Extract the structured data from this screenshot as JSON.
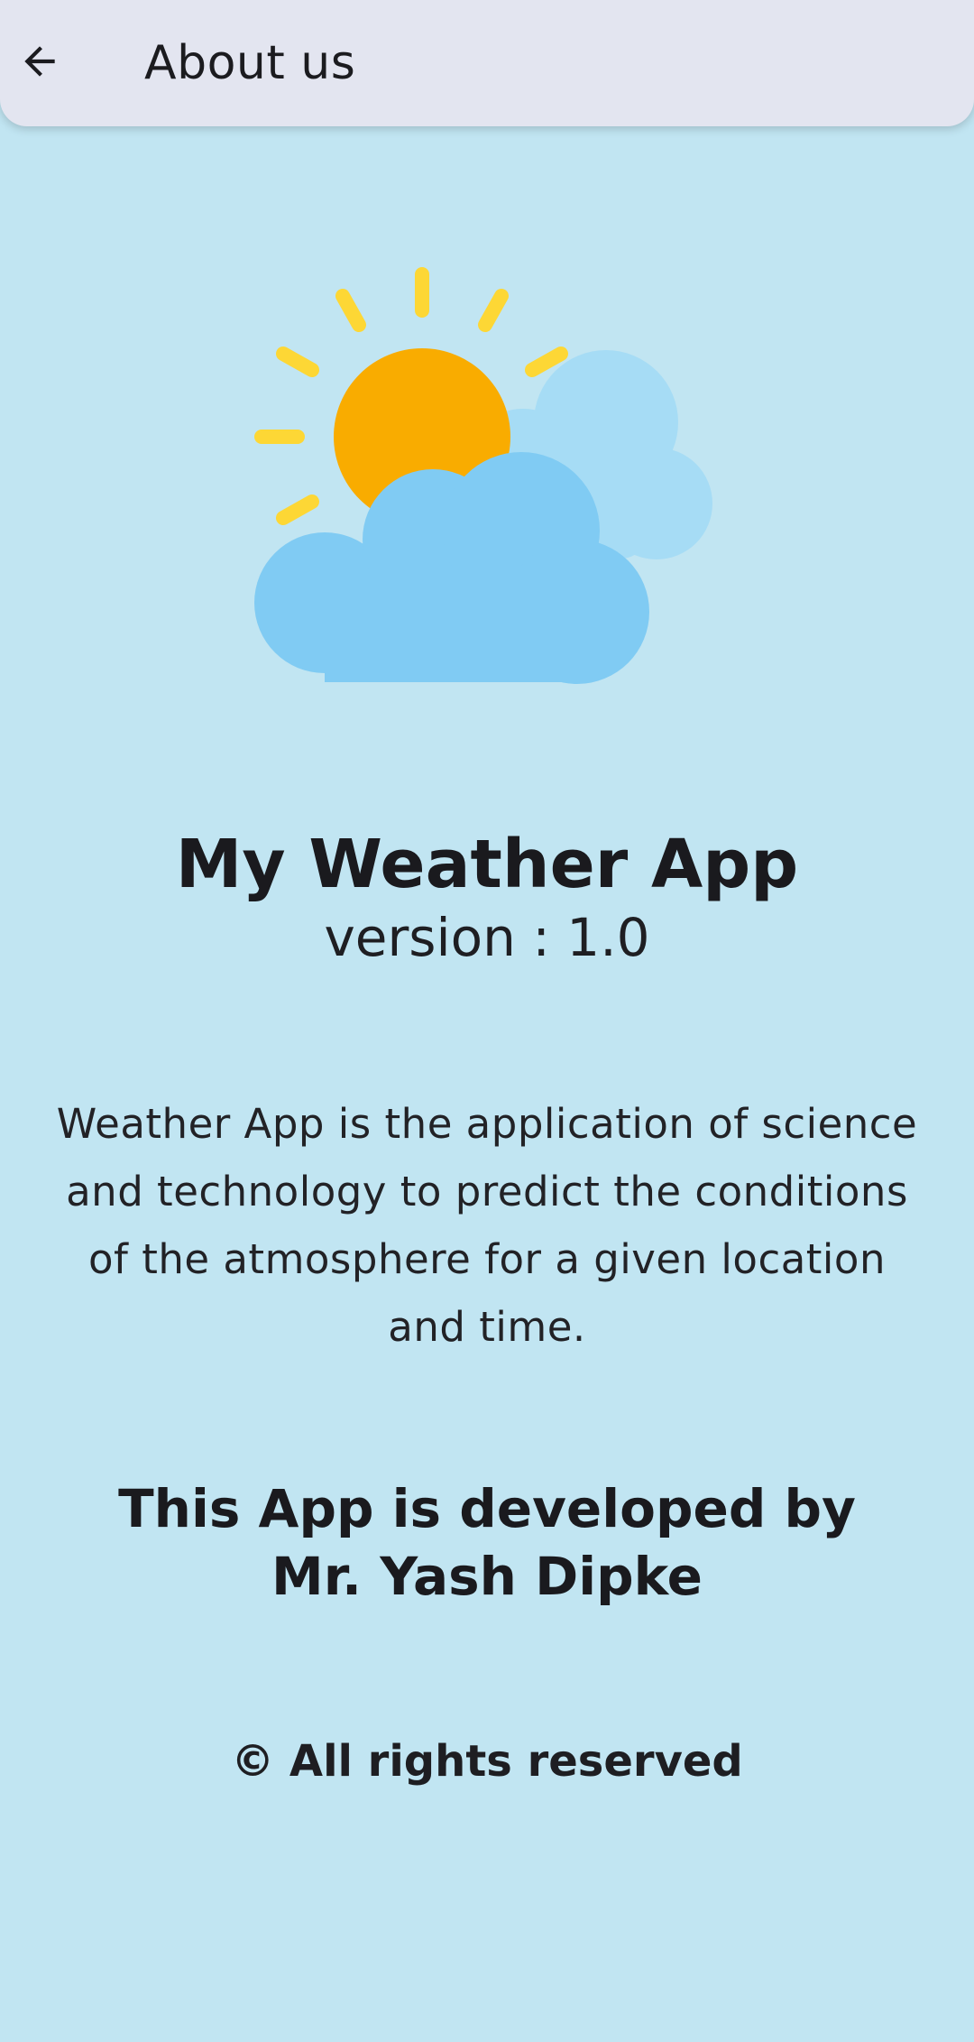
{
  "app_bar": {
    "title": "About us",
    "back_icon": "arrow-back-icon"
  },
  "illustration": {
    "icon": "sun-behind-cloud-icon",
    "colors": {
      "sun": "#f9ac00",
      "sun_rays": "#fdd735",
      "cloud_back": "#a6dcf5",
      "cloud_front": "#80cbf3"
    }
  },
  "main": {
    "app_name": "My Weather App",
    "version": "version : 1.0",
    "description": "Weather App is the application of science and technology to predict the conditions of the atmosphere for a given location and time.",
    "developer_line1": "This App is developed by",
    "developer_line2": "Mr. Yash Dipke",
    "copyright": "© All rights reserved"
  },
  "colors": {
    "background": "#c1e5f2",
    "app_bar": "#e3e5f0",
    "text": "#1e1e22"
  }
}
